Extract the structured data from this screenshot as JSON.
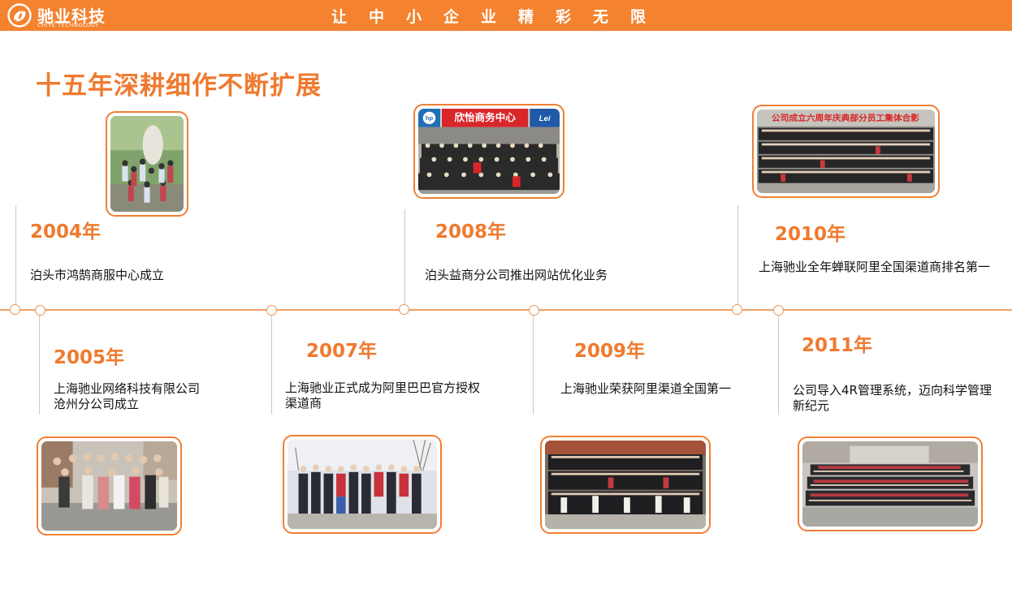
{
  "header": {
    "brand_name": "驰业科技",
    "brand_sub": "CHIYE TECHNOLOGY",
    "slogan": "让中小企业精彩无限",
    "logo_icon": "swirl-logo-icon",
    "color": "#f4822e"
  },
  "title": "十五年深耕细作不断扩展",
  "accent_color": "#ef7a2f",
  "timeline": [
    {
      "year": "2004年",
      "text": "泊头市鸿鹄商服中心成立",
      "position": "above"
    },
    {
      "year": "2005年",
      "text": "上海驰业网络科技有限公司沧州分公司成立",
      "position": "below"
    },
    {
      "year": "2007年",
      "text": "上海驰业正式成为阿里巴巴官方授权渠道商",
      "position": "below"
    },
    {
      "year": "2008年",
      "text": "泊头益商分公司推出网站优化业务",
      "position": "above"
    },
    {
      "year": "2009年",
      "text": "上海驰业荣获阿里渠道全国第一",
      "position": "below"
    },
    {
      "year": "2010年",
      "text": "上海驰业全年蝉联阿里全国渠道商排名第一",
      "position": "above"
    },
    {
      "year": "2011年",
      "text": "公司导入4R管理系统，迈向科学管理新纪元",
      "position": "below"
    }
  ],
  "photos": {
    "p2008_sign": "欣怡商务中心",
    "p2008_brand_left": "hp",
    "p2008_brand_right": "Lei",
    "p2010_banner": "公司成立六周年庆典部分员工集体合影"
  }
}
